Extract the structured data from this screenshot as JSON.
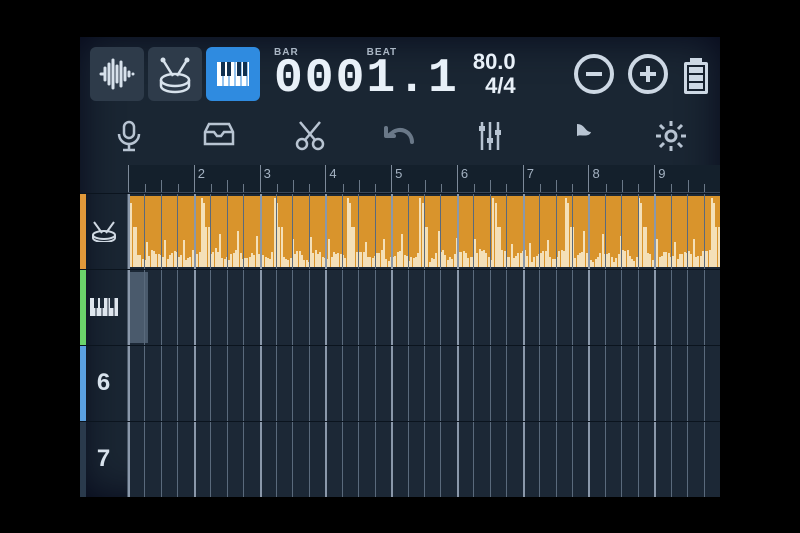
{
  "header": {
    "bar_label": "BAR",
    "beat_label": "BEAT",
    "counter": "0001.1",
    "tempo": "80.0",
    "time_signature": "4/4"
  },
  "modes": [
    {
      "name": "audio",
      "active": false
    },
    {
      "name": "drums",
      "active": false
    },
    {
      "name": "keys",
      "active": true
    }
  ],
  "tools": [
    "mic",
    "folder",
    "cut",
    "undo",
    "mixer",
    "marker",
    "settings"
  ],
  "ruler_bars": [
    "",
    "2",
    "3",
    "4",
    "5",
    "6",
    "7",
    "8",
    "9"
  ],
  "tracks": [
    {
      "kind": "drum",
      "label": ""
    },
    {
      "kind": "keys",
      "label": ""
    },
    {
      "kind": "t6",
      "label": "6"
    },
    {
      "kind": "t7",
      "label": "7"
    }
  ],
  "colors": {
    "accent": "#2f8be0",
    "clip": "#d9942c"
  }
}
